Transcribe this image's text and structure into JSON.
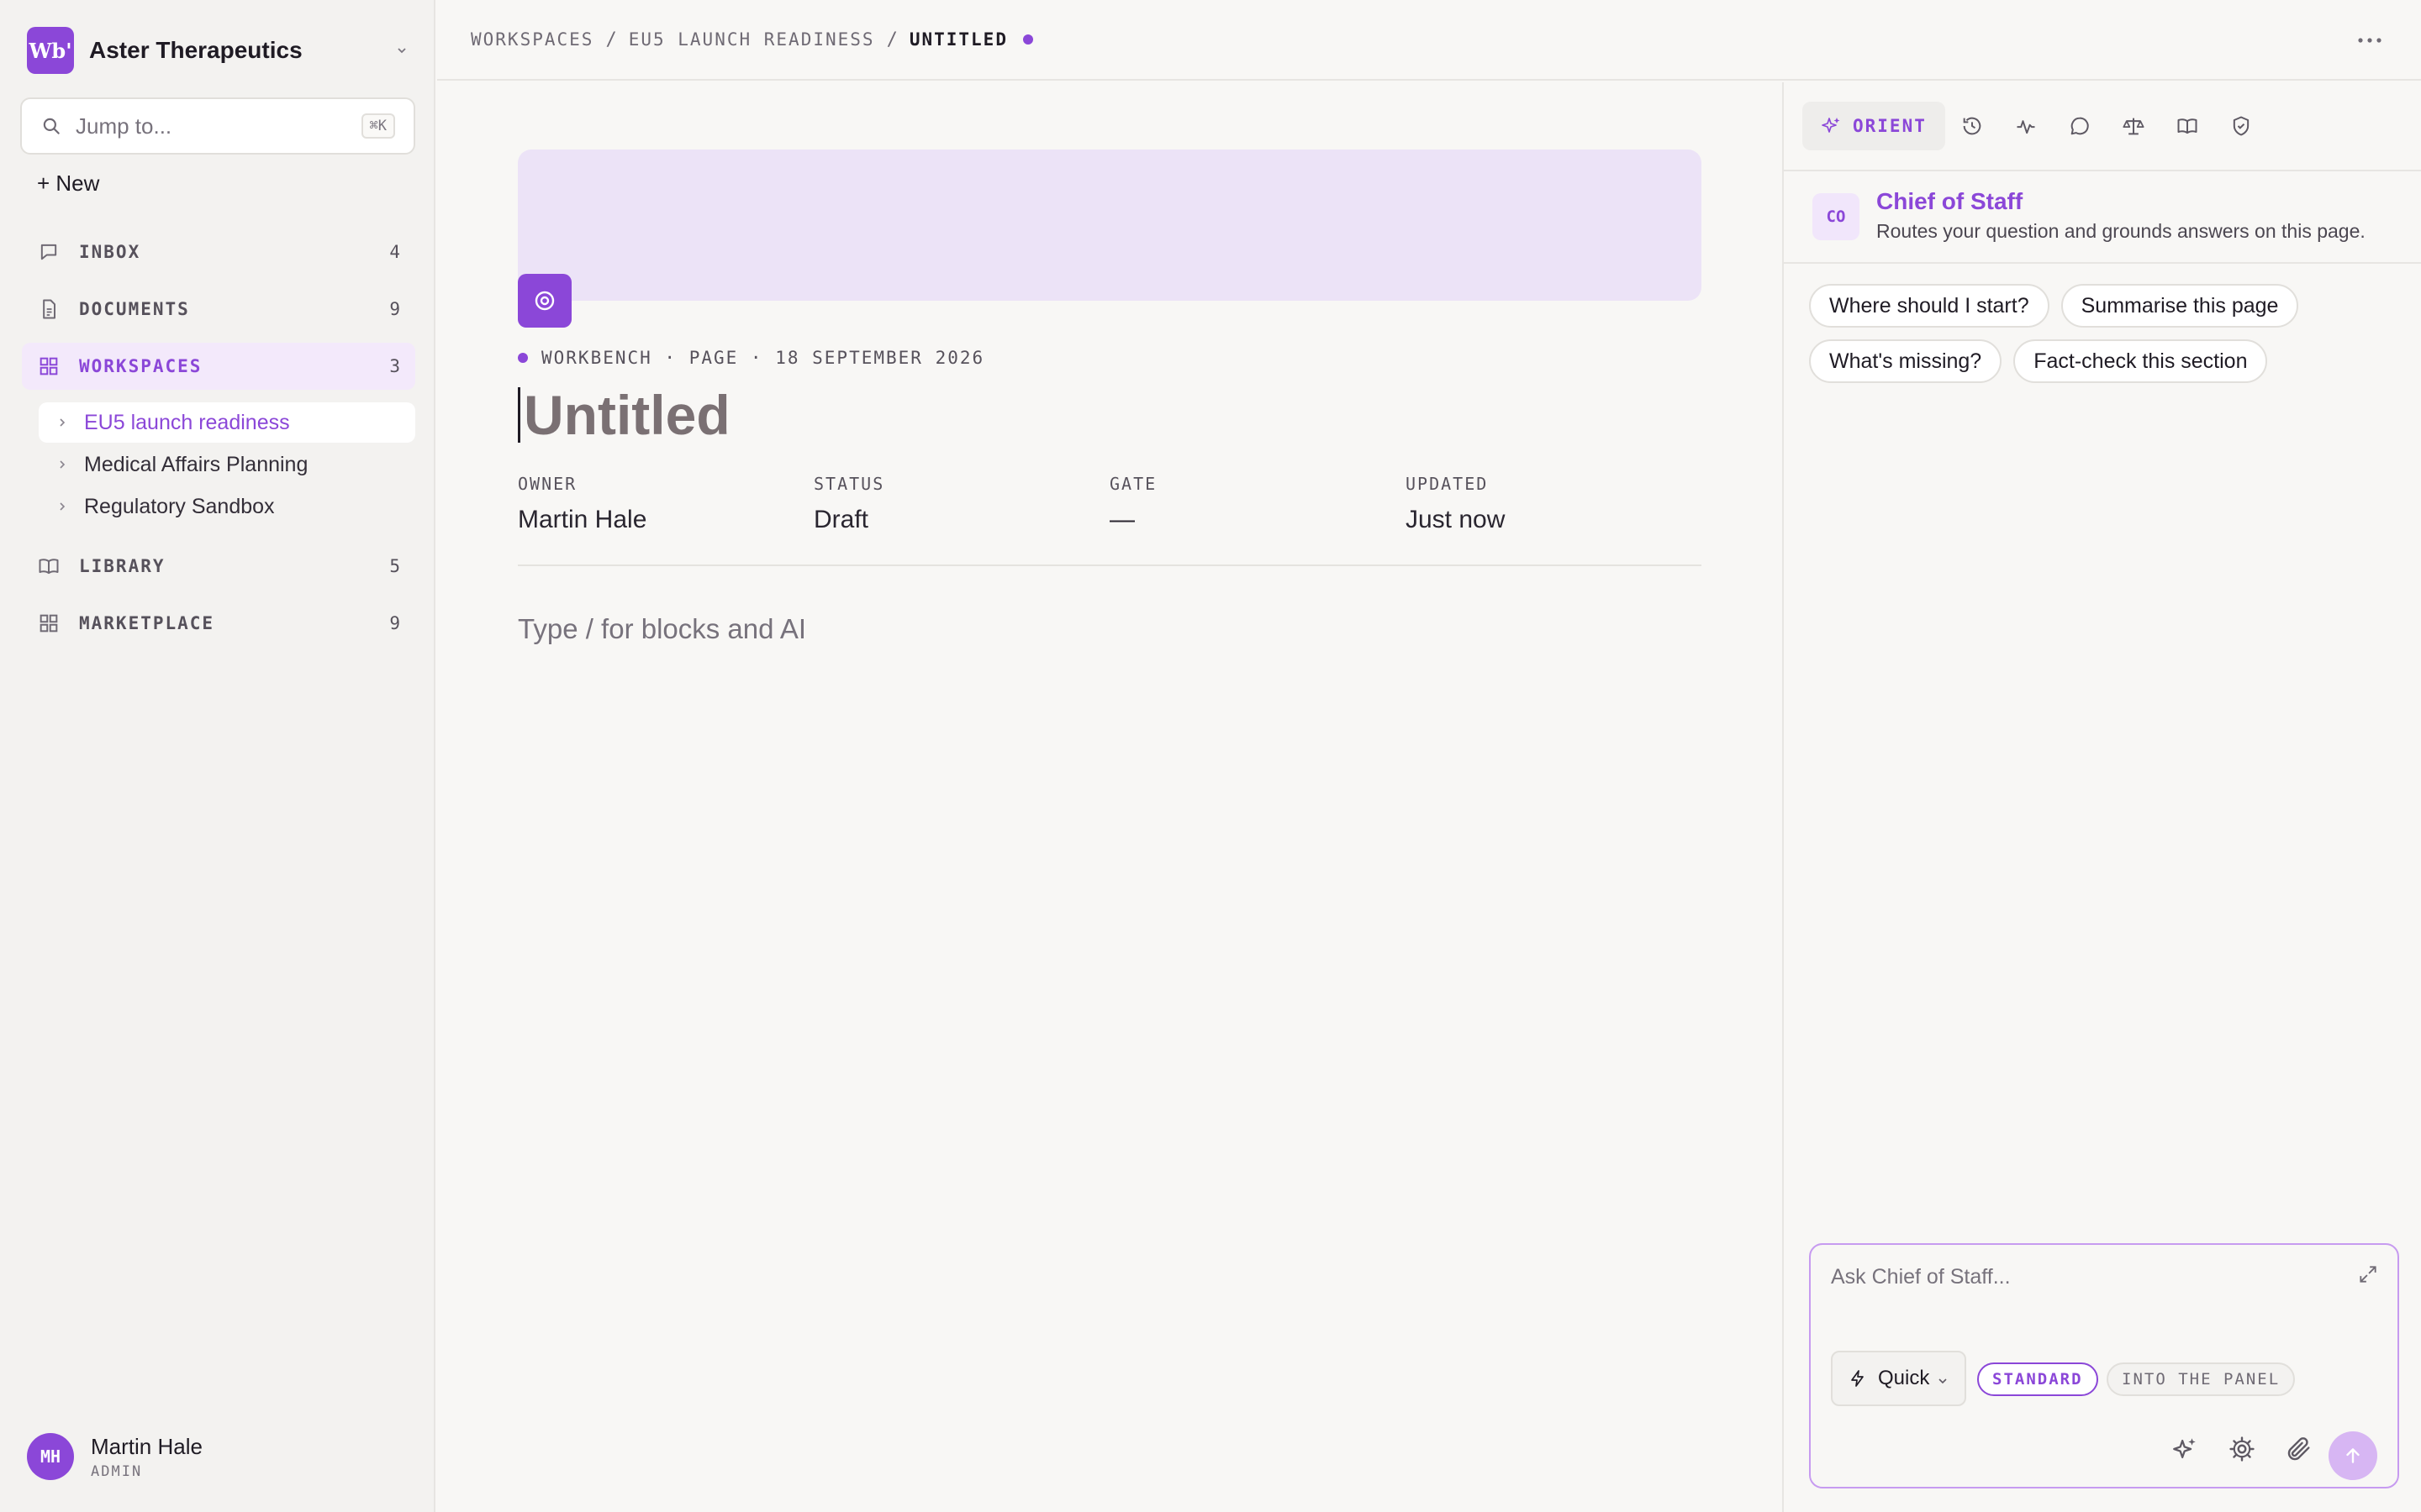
{
  "sidebar": {
    "org_logo": "Wb'",
    "org_name": "Aster Therapeutics",
    "jump_placeholder": "Jump to...",
    "jump_shortcut": "⌘K",
    "new_label": "+ New",
    "nav": [
      {
        "label": "INBOX",
        "count": "4",
        "icon": "message-icon"
      },
      {
        "label": "DOCUMENTS",
        "count": "9",
        "icon": "document-icon"
      },
      {
        "label": "WORKSPACES",
        "count": "3",
        "icon": "grid-icon",
        "active": true
      },
      {
        "label": "LIBRARY",
        "count": "5",
        "icon": "book-icon"
      },
      {
        "label": "MARKETPLACE",
        "count": "9",
        "icon": "grid-icon"
      }
    ],
    "workspaces": [
      {
        "label": "EU5 launch readiness",
        "selected": true
      },
      {
        "label": "Medical Affairs Planning"
      },
      {
        "label": "Regulatory Sandbox"
      }
    ],
    "user": {
      "initials": "MH",
      "name": "Martin Hale",
      "role": "ADMIN"
    }
  },
  "breadcrumb": [
    "WORKSPACES",
    "EU5 LAUNCH READINESS",
    "UNTITLED"
  ],
  "page": {
    "meta": "WORKBENCH · PAGE · 18 SEPTEMBER 2026",
    "title": "Untitled",
    "properties": [
      {
        "label": "OWNER",
        "value": "Martin Hale"
      },
      {
        "label": "STATUS",
        "value": "Draft"
      },
      {
        "label": "GATE",
        "value": "—"
      },
      {
        "label": "UPDATED",
        "value": "Just now"
      }
    ],
    "body_placeholder": "Type / for blocks and AI"
  },
  "panel": {
    "active_tab": "ORIENT",
    "tab_icons": [
      "history-icon",
      "activity-icon",
      "comment-icon",
      "scale-icon",
      "book-icon",
      "shield-check-icon"
    ],
    "agent": {
      "initials": "CO",
      "name": "Chief of Staff",
      "description": "Routes your question and grounds answers on this page."
    },
    "suggestions": [
      "Where should I start?",
      "Summarise this page",
      "What's missing?",
      "Fact-check this section"
    ],
    "composer": {
      "placeholder": "Ask Chief of Staff...",
      "mode": "Quick",
      "pill_standard": "STANDARD",
      "pill_into": "INTO THE PANEL"
    }
  },
  "colors": {
    "accent": "#8b47d8",
    "cover": "#ece3f7",
    "background": "#f8f7f5"
  }
}
